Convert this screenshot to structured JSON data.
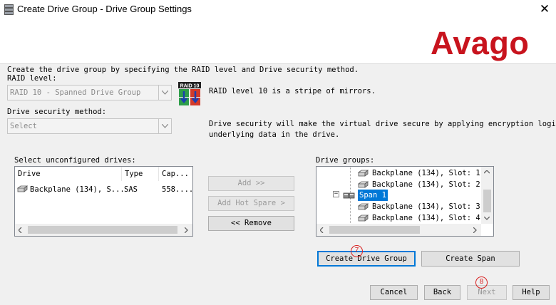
{
  "window": {
    "title": "Create Drive Group - Drive Group Settings",
    "close_glyph": "✕"
  },
  "header": {
    "logo_text": "Avago"
  },
  "intro_text": "Create the drive group by specifying the RAID level and Drive security method.",
  "raid": {
    "label": "RAID level:",
    "selected": "RAID 10 - Spanned Drive Group",
    "icon_text": "RAID 10",
    "description": "RAID level 10 is a stripe of mirrors."
  },
  "security": {
    "label": "Drive security method:",
    "selected": "Select",
    "description_line1": "Drive security will make the virtual drive secure by applying encryption logic to",
    "description_line2": "underlying data in the drive."
  },
  "unconfigured": {
    "label": "Select unconfigured drives:",
    "columns": [
      "Drive",
      "Type",
      "Cap..."
    ],
    "rows": [
      {
        "drive": "Backplane (134), S...",
        "type": "SAS",
        "cap": "558...."
      }
    ]
  },
  "transfer_buttons": {
    "add": "Add >>",
    "add_hot_spare": "Add Hot Spare >",
    "remove": "<< Remove"
  },
  "drive_groups": {
    "label": "Drive groups:",
    "items": [
      {
        "label": "Backplane (134), Slot: 1:"
      },
      {
        "label": "Backplane (134), Slot: 2:"
      },
      {
        "label": "Span 1"
      },
      {
        "label": "Backplane (134), Slot: 3:"
      },
      {
        "label": "Backplane (134), Slot: 4:"
      }
    ],
    "expander": "−"
  },
  "actions": {
    "create_drive_group": "Create Drive Group",
    "create_span": "Create Span"
  },
  "nav": {
    "cancel": "Cancel",
    "back": "Back",
    "next": "Next",
    "help": "Help"
  },
  "callouts": {
    "seven": "7",
    "eight": "8"
  },
  "colors": {
    "logo": "#c8141e",
    "selection": "#0078d7",
    "callout": "#d82020"
  }
}
